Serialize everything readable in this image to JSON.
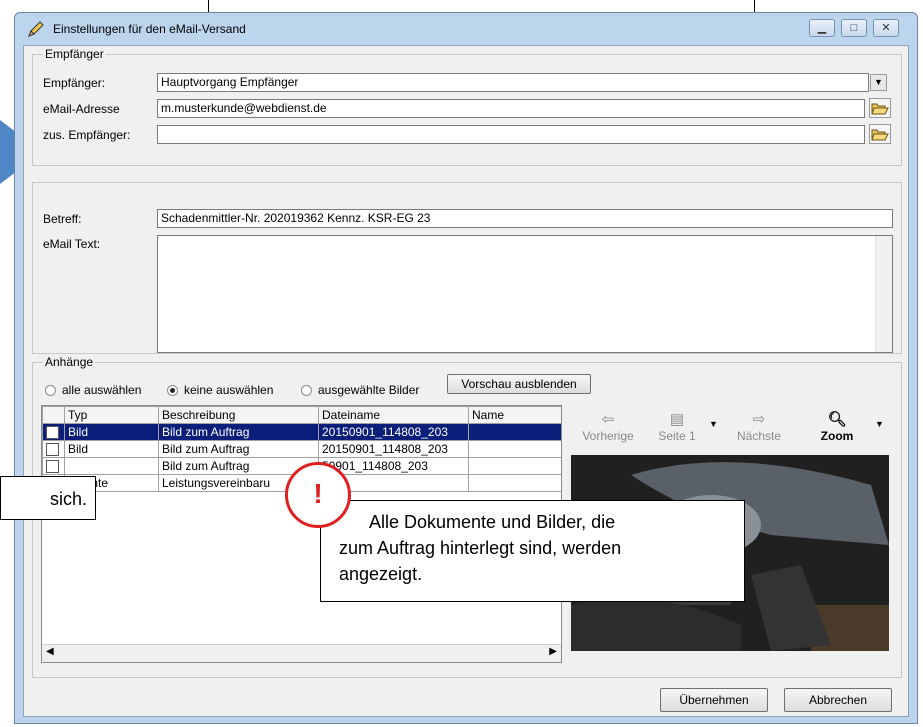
{
  "window": {
    "title": "Einstellungen für den eMail-Versand",
    "controls": [
      "minimize",
      "maximize",
      "close"
    ]
  },
  "recipient_group": {
    "legend": "Empfänger",
    "recipient_label": "Empfänger:",
    "recipient_value": "Hauptvorgang Empfänger",
    "email_label": "eMail-Adresse",
    "email_value": "m.musterkunde@webdienst.de",
    "cc_label": "zus. Empfänger:",
    "cc_value": ""
  },
  "message_group": {
    "subject_label": "Betreff:",
    "subject_value": "Schadenmittler-Nr. 202019362   Kennz. KSR-EG 23",
    "body_label": "eMail Text:",
    "body_value": ""
  },
  "attachments": {
    "legend": "Anhänge",
    "radio_all": "alle auswählen",
    "radio_none": "keine auswählen",
    "radio_selected": "ausgewählte Bilder",
    "selected_radio": "keine auswählen",
    "preview_toggle": "Vorschau ausblenden",
    "columns": [
      "Typ",
      "Beschreibung",
      "Dateiname",
      "Name"
    ],
    "rows": [
      {
        "type": "Bild",
        "desc": "Bild zum Auftrag",
        "file": "20150901_114808_203",
        "name": ""
      },
      {
        "type": "Bild",
        "desc": "Bild zum Auftrag",
        "file": "20150901_114808_203",
        "name": ""
      },
      {
        "type": "",
        "desc": "Bild zum Auftrag",
        "file": "50901_114808_203",
        "name": ""
      },
      {
        "type": "umente",
        "desc": "Leistungsvereinbaru",
        "file": "",
        "name": ""
      }
    ],
    "preview_toolbar": {
      "prev": "Vorherige",
      "page": "Seite 1",
      "next": "Nächste",
      "zoom": "Zoom"
    }
  },
  "footer": {
    "apply": "Übernehmen",
    "cancel": "Abbrechen"
  },
  "callouts": {
    "warning_mark": "!",
    "main_text_line1": "Alle Dokumente und Bilder, die",
    "main_text_line2": "zum Auftrag hinterlegt sind, werden",
    "main_text_line3": "angezeigt.",
    "left_text": "sich."
  },
  "colors": {
    "selection": "#0a1e7a",
    "arrow": "#4f86c6",
    "warning": "#e02020"
  }
}
